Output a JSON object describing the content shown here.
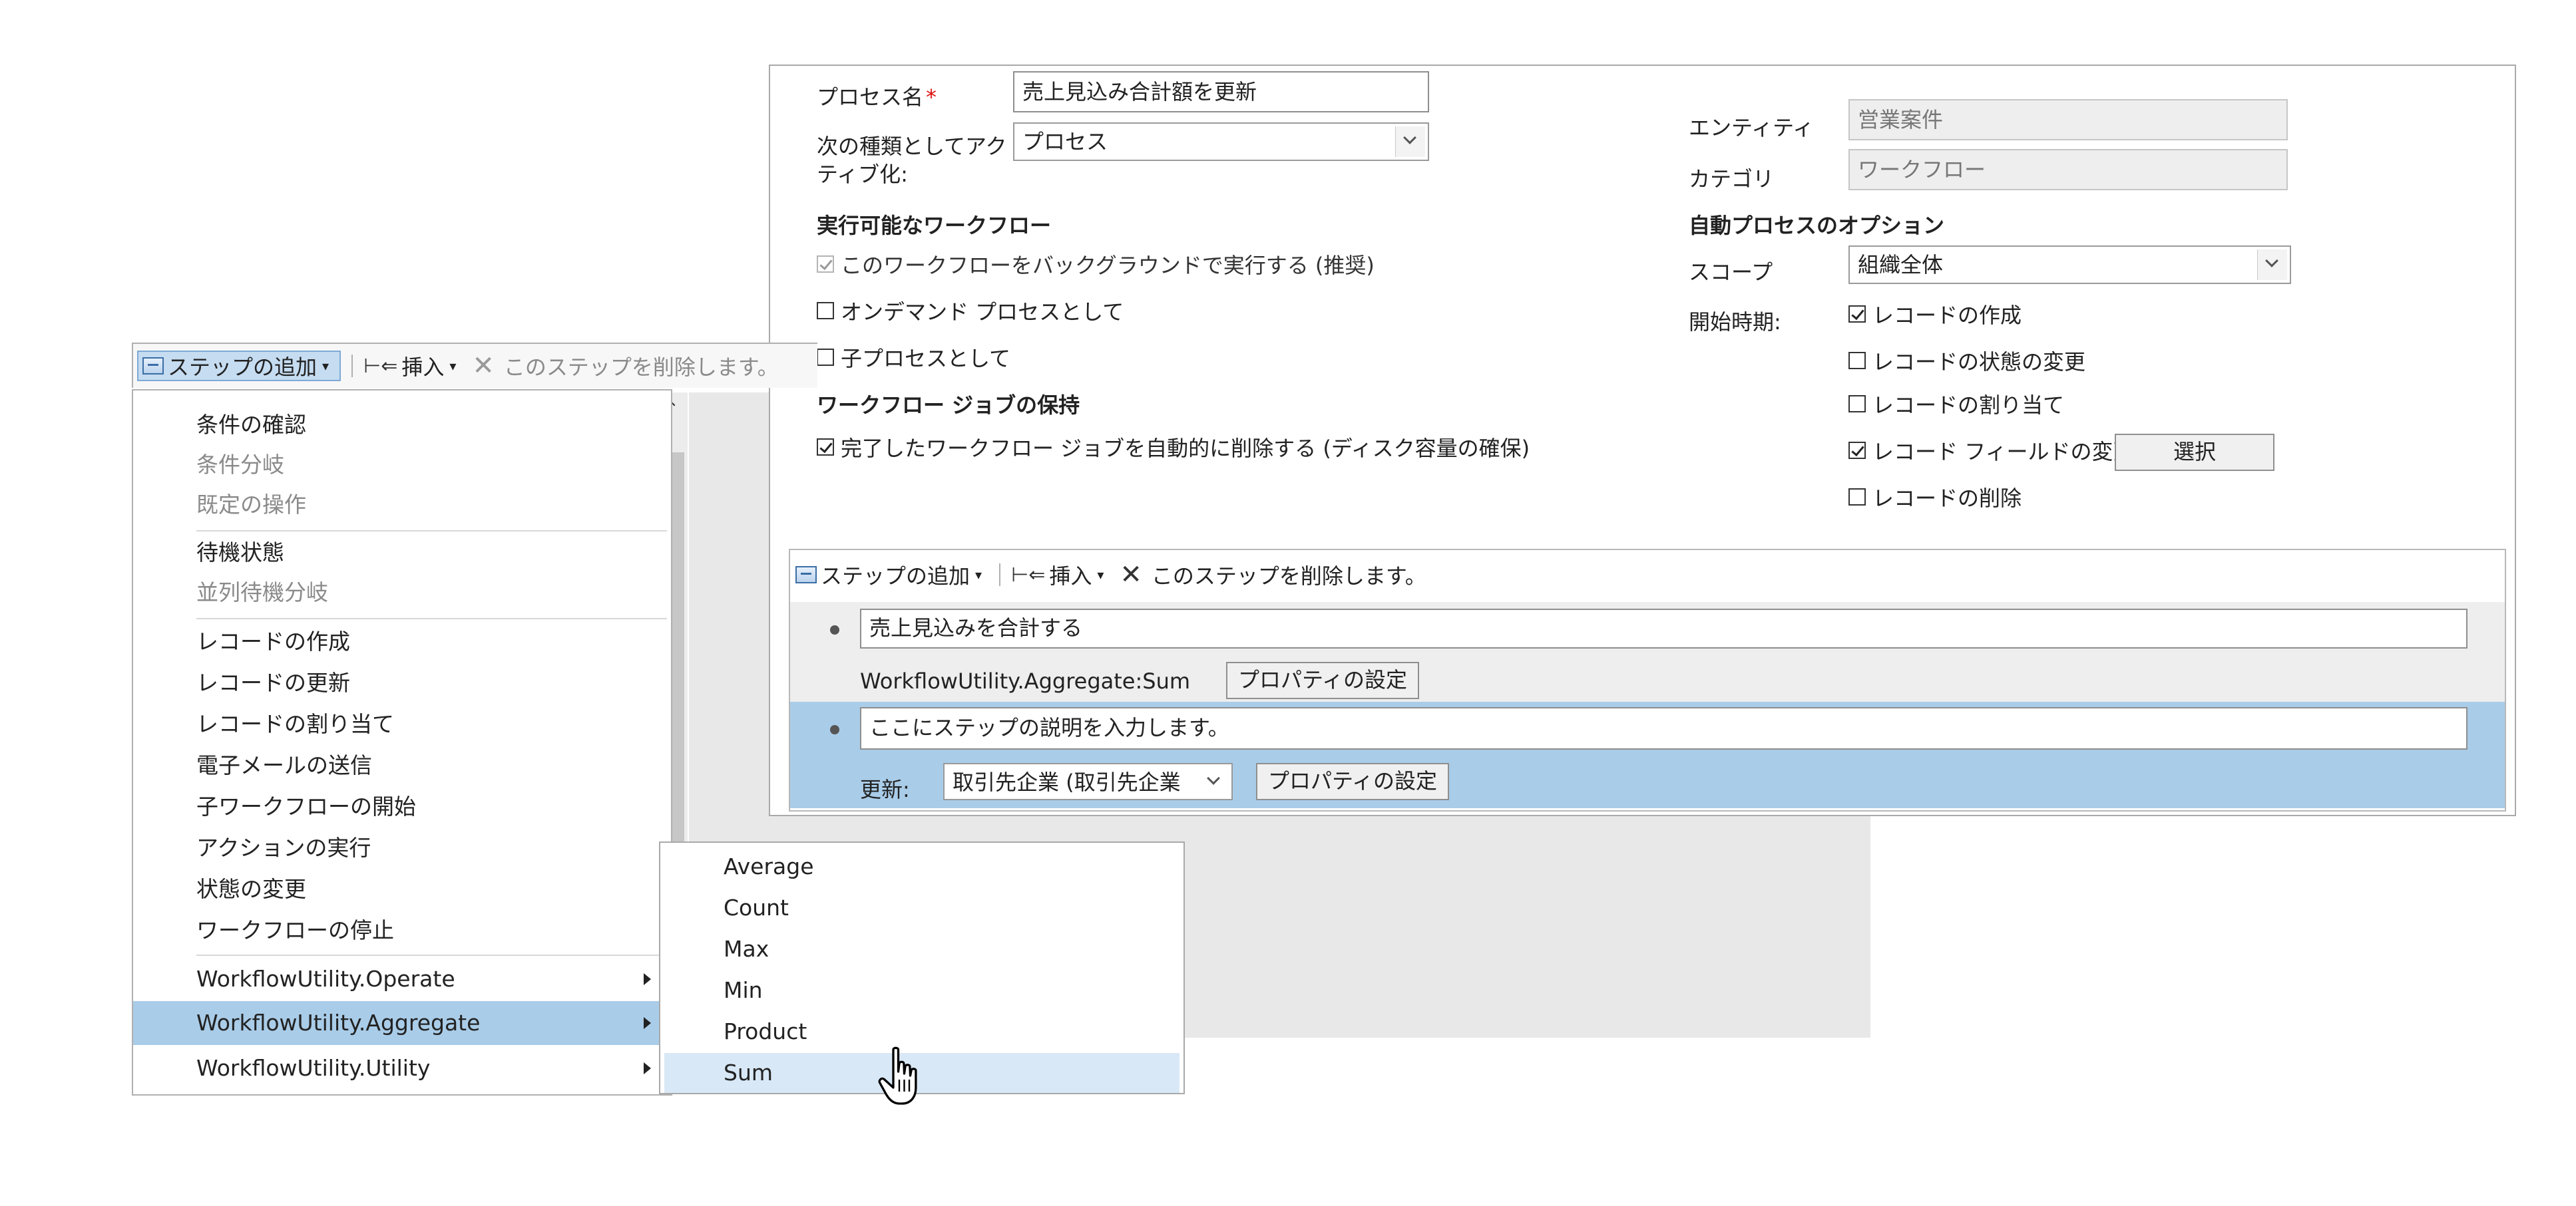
{
  "process": {
    "name_label": "プロセス名",
    "required_mark": "*",
    "name_value": "売上見込み合計額を更新",
    "activate_label": "次の種類としてアクティブ化:",
    "activate_label_line1": "次の種類としてアク",
    "activate_label_line2": "ティブ化:",
    "activate_value": "プロセス",
    "entity_label": "エンティティ",
    "entity_value": "営業案件",
    "category_label": "カテゴリ",
    "category_value": "ワークフロー",
    "runnable_heading": "実行可能なワークフロー",
    "run_background": "このワークフローをバックグラウンドで実行する (推奨)",
    "on_demand": "オンデマンド プロセスとして",
    "child_process": "子プロセスとして",
    "retention_heading": "ワークフロー ジョブの保持",
    "auto_delete": "完了したワークフロー ジョブを自動的に削除する (ディスク容量の確保)",
    "auto_options_heading": "自動プロセスのオプション",
    "scope_label": "スコープ",
    "scope_value": "組織全体",
    "start_label": "開始時期:",
    "start_options": [
      {
        "label": "レコードの作成",
        "checked": true
      },
      {
        "label": "レコードの状態の変更",
        "checked": false
      },
      {
        "label": "レコードの割り当て",
        "checked": false
      },
      {
        "label": "レコード フィールドの変更",
        "checked": true
      },
      {
        "label": "レコードの削除",
        "checked": false
      }
    ],
    "select_button": "選択"
  },
  "toolbar": {
    "add_step": "ステップの追加",
    "insert": "挿入",
    "delete_step": "このステップを削除します。"
  },
  "steps": [
    {
      "description": "売上見込みを合計する",
      "action_text": "WorkflowUtility.Aggregate:Sum",
      "button": "プロパティの設定"
    },
    {
      "description": "ここにステップの説明を入力します。",
      "update_label": "更新:",
      "update_value": "取引先企業 (取引先企業",
      "button": "プロパティの設定"
    }
  ],
  "menu": {
    "items": [
      {
        "label": "条件の確認",
        "disabled": false
      },
      {
        "label": "条件分岐",
        "disabled": true
      },
      {
        "label": "既定の操作",
        "disabled": true
      },
      {
        "label": "待機状態",
        "disabled": false
      },
      {
        "label": "並列待機分岐",
        "disabled": true
      },
      {
        "label": "レコードの作成",
        "disabled": false
      },
      {
        "label": "レコードの更新",
        "disabled": false
      },
      {
        "label": "レコードの割り当て",
        "disabled": false
      },
      {
        "label": "電子メールの送信",
        "disabled": false
      },
      {
        "label": "子ワークフローの開始",
        "disabled": false
      },
      {
        "label": "アクションの実行",
        "disabled": false
      },
      {
        "label": "状態の変更",
        "disabled": false
      },
      {
        "label": "ワークフローの停止",
        "disabled": false
      },
      {
        "label": "WorkflowUtility.Operate",
        "disabled": false
      },
      {
        "label": "WorkflowUtility.Aggregate",
        "disabled": false
      },
      {
        "label": "WorkflowUtility.Utility",
        "disabled": false
      }
    ]
  },
  "submenu": {
    "items": [
      "Average",
      "Count",
      "Max",
      "Min",
      "Product",
      "Sum"
    ]
  },
  "colors": {
    "highlight": "#a9cce8",
    "selected_step": "#a9cce8",
    "submenu_hover": "#d9e8f6",
    "required": "#dd1111"
  }
}
